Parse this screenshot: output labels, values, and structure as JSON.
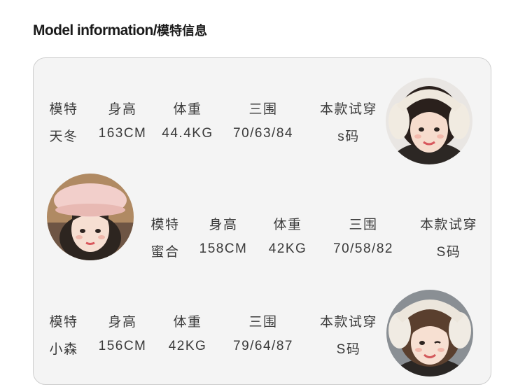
{
  "title_en": "Model information/",
  "title_cn": "模特信息",
  "headers": [
    "模特",
    "身高",
    "体重",
    "三围",
    "本款试穿"
  ],
  "models": [
    {
      "name": "天冬",
      "height": "163CM",
      "weight": "44.4KG",
      "measurements": "70/63/84",
      "size": "s码"
    },
    {
      "name": "蜜合",
      "height": "158CM",
      "weight": "42KG",
      "measurements": "70/58/82",
      "size": "S码"
    },
    {
      "name": "小森",
      "height": "156CM",
      "weight": "42KG",
      "measurements": "79/64/87",
      "size": "S码"
    }
  ]
}
